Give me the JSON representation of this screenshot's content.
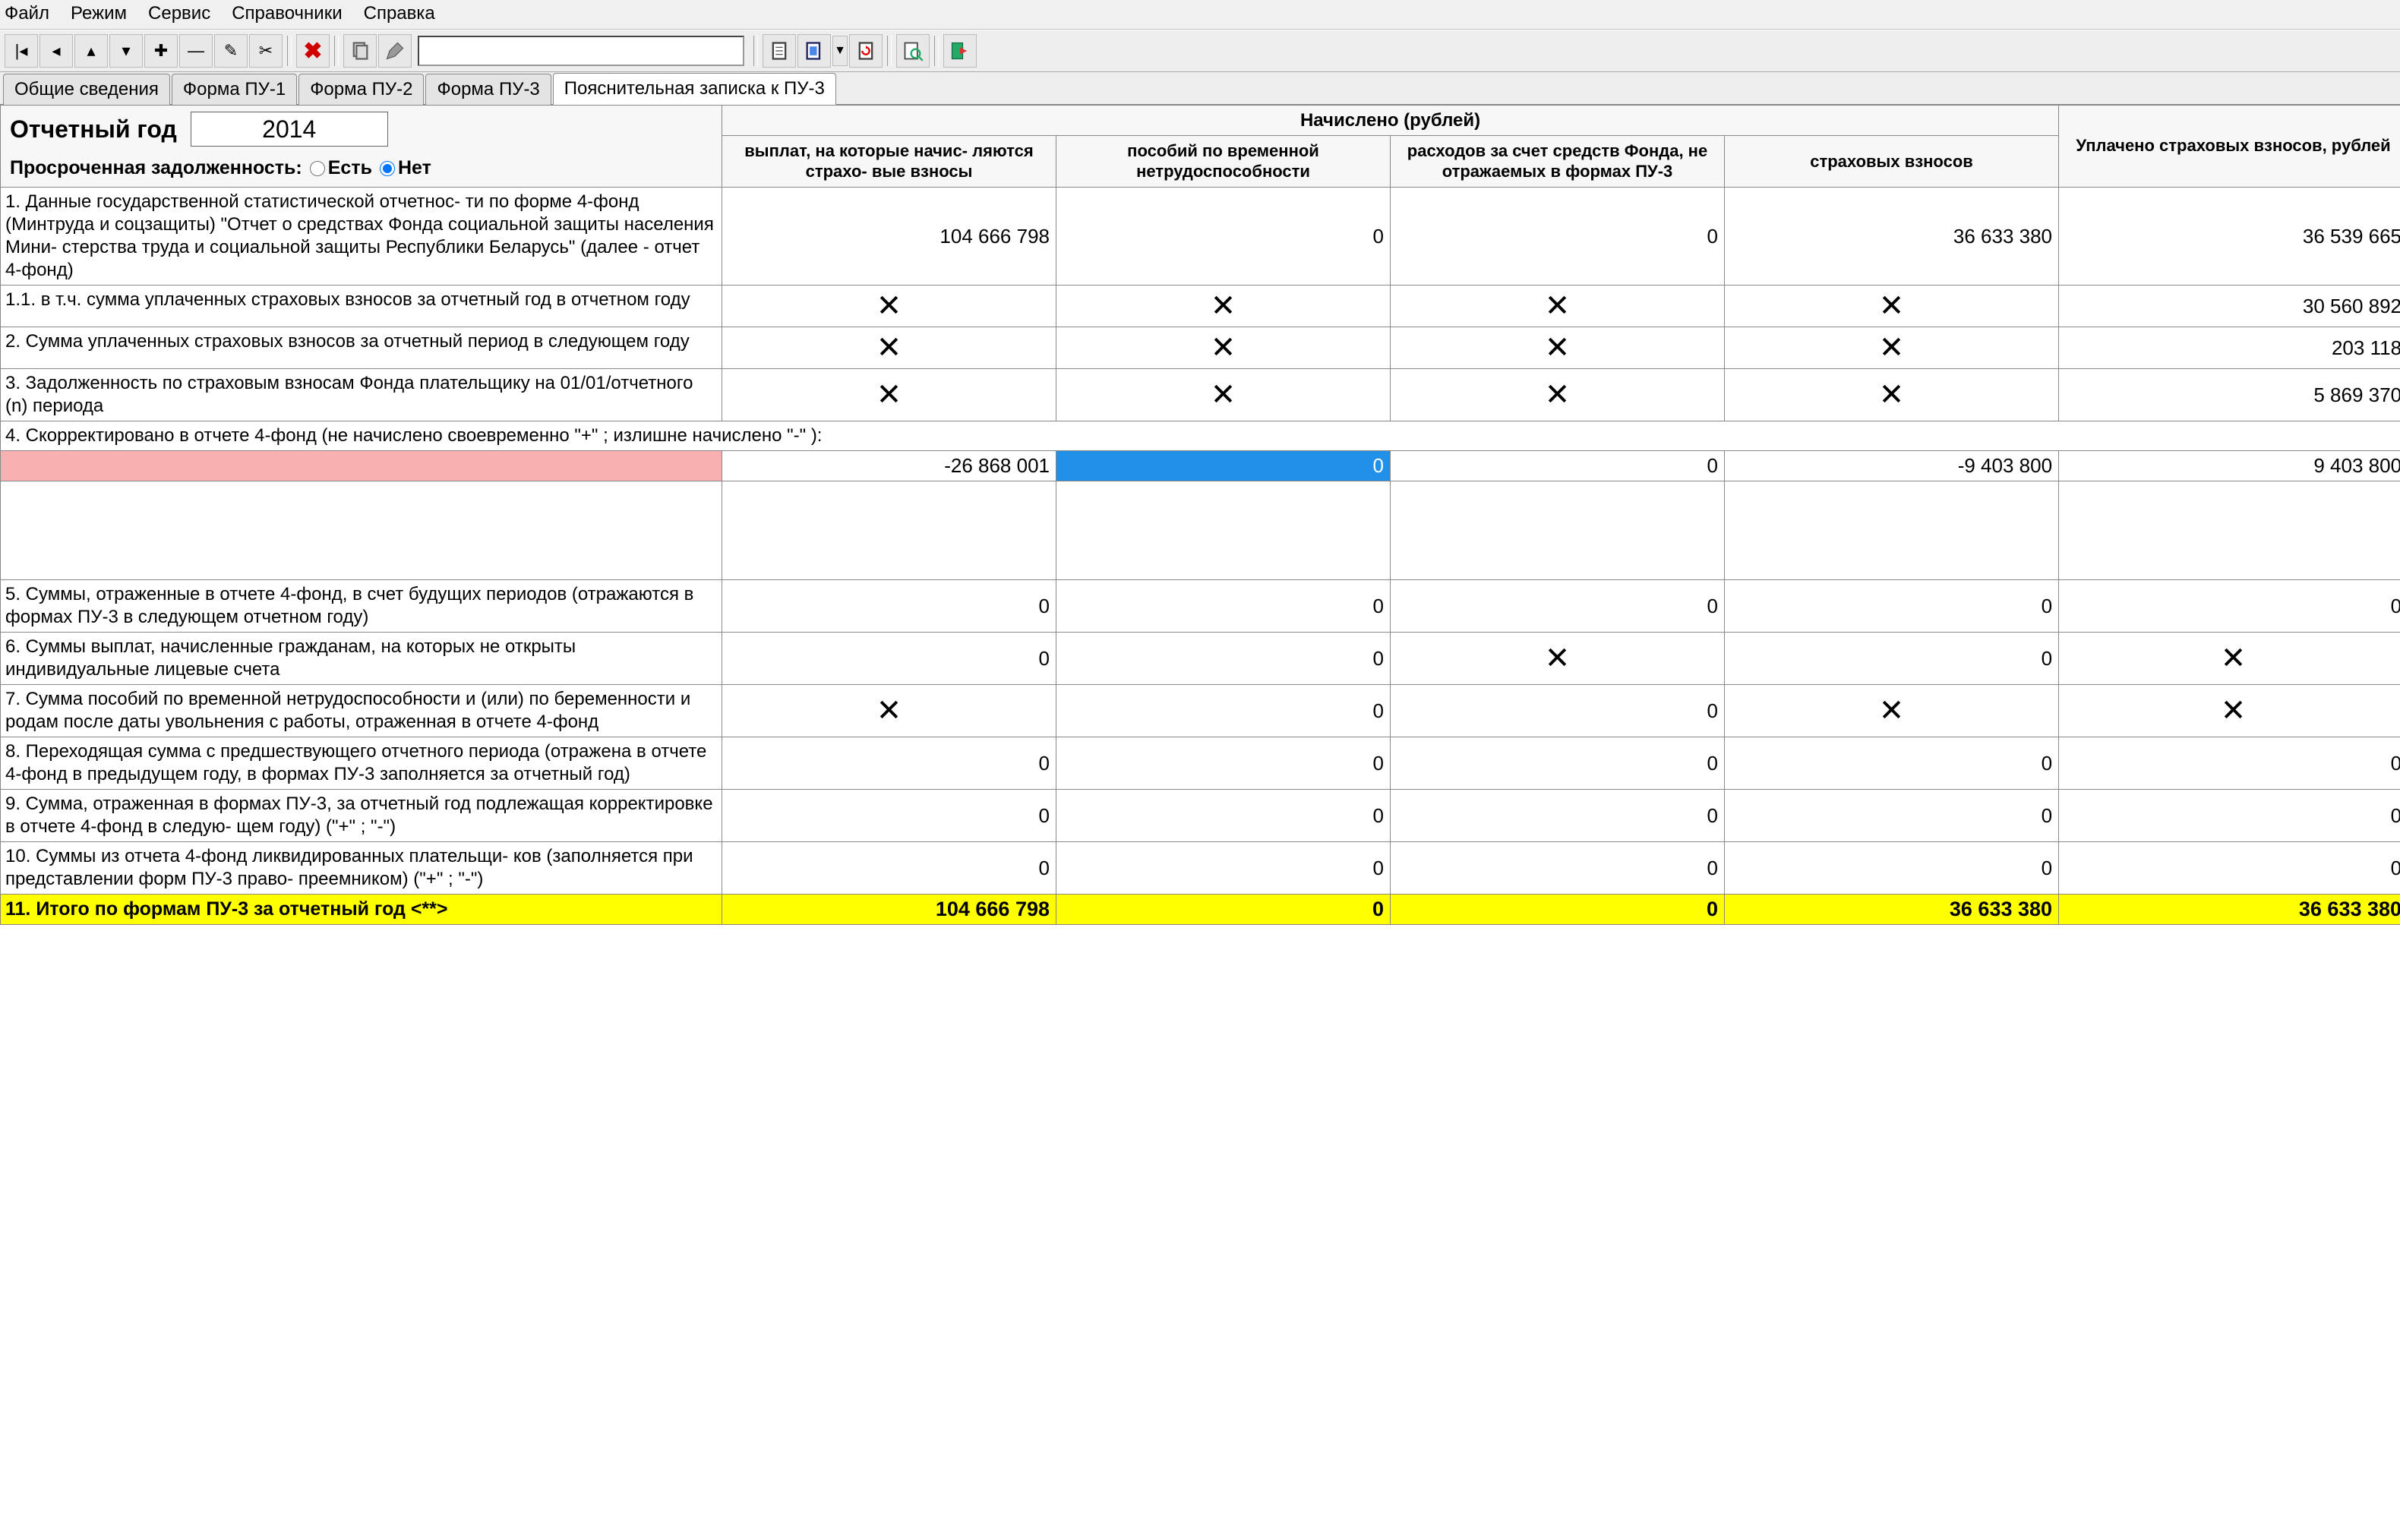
{
  "menu": {
    "file": "Файл",
    "mode": "Режим",
    "service": "Сервис",
    "dict": "Справочники",
    "help": "Справка"
  },
  "tabs": {
    "t1": "Общие сведения",
    "t2": "Форма ПУ-1",
    "t3": "Форма ПУ-2",
    "t4": "Форма ПУ-3",
    "t5": "Пояснительная записка к ПУ-3"
  },
  "header": {
    "year_label": "Отчетный год",
    "year_value": "2014",
    "overdue_label": "Просроченная задолженность:",
    "opt_yes": "Есть",
    "opt_no": "Нет"
  },
  "th": {
    "accrued": "Начислено (рублей)",
    "paid": "Уплачено страховых взносов, рублей",
    "c1": "выплат, на которые начис-\nляются страхо-\nвые взносы",
    "c2": "пособий по временной нетрудоспособности",
    "c3": "расходов за счет средств Фонда, не отражаемых в формах ПУ-3",
    "c4": "страховых взносов"
  },
  "rows": {
    "r1": {
      "desc": "1. Данные государственной статистической отчетнос-\nти по форме 4-фонд (Минтруда и соцзащиты) \"Отчет о средствах Фонда социальной защиты населения Мини-\nстерства труда и социальной защиты Республики Беларусь\" (далее - отчет 4-фонд)",
      "v1": "104 666 798",
      "v2": "0",
      "v3": "0",
      "v4": "36 633 380",
      "v5": "36 539 665"
    },
    "r11": {
      "desc": "  1.1. в т.ч. сумма уплаченных страховых взносов за отчетный год в отчетном году",
      "v5": "30 560 892"
    },
    "r2": {
      "desc": "2. Сумма уплаченных страховых взносов за отчетный период в следующем году",
      "v5": "203 118"
    },
    "r3": {
      "desc": "3. Задолженность по страховым взносам Фонда плательщику на 01/01/отчетного (n) периода",
      "v5": "5 869 370"
    },
    "r4": {
      "desc": "4. Скорректировано в отчете 4-фонд  (не начислено своевременно \"+\" ; излишне начислено \"-\" ):",
      "v1": "-26 868 001",
      "v2": "0",
      "v3": "0",
      "v4": "-9 403 800",
      "v5": "9 403 800"
    },
    "r5": {
      "desc": "5. Суммы, отраженные в отчете 4-фонд, в счет будущих периодов (отражаются в формах ПУ-3 в следующем отчетном году)",
      "v1": "0",
      "v2": "0",
      "v3": "0",
      "v4": "0",
      "v5": "0"
    },
    "r6": {
      "desc": "6. Суммы выплат, начисленные гражданам, на которых не открыты индивидуальные лицевые счета",
      "v1": "0",
      "v2": "0",
      "v4": "0"
    },
    "r7": {
      "desc": "7. Сумма пособий по временной нетрудоспособности и (или) по беременности и родам после даты увольнения с работы, отраженная в отчете  4-фонд",
      "v2": "0",
      "v3": "0"
    },
    "r8": {
      "desc": "8. Переходящая сумма с предшествующего отчетного периода (отражена в отчете 4-фонд в предыдущем году, в формах ПУ-3 заполняется за отчетный год)",
      "v1": "0",
      "v2": "0",
      "v3": "0",
      "v4": "0",
      "v5": "0"
    },
    "r9": {
      "desc": "9. Сумма, отраженная в формах ПУ-3, за отчетный год подлежащая корректировке в отчете 4-фонд в следую-\nщем году) (\"+\" ; \"-\")",
      "v1": "0",
      "v2": "0",
      "v3": "0",
      "v4": "0",
      "v5": "0"
    },
    "r10": {
      "desc": "10. Суммы из отчета 4-фонд  ликвидированных плательщи-\nков (заполняется при представлении форм ПУ-3 право-\nпреемником) (\"+\" ; \"-\")",
      "v1": "0",
      "v2": "0",
      "v3": "0",
      "v4": "0",
      "v5": "0"
    },
    "r11t": {
      "desc": "11. Итого по формам ПУ-3 за отчетный год  <**>",
      "v1": "104 666 798",
      "v2": "0",
      "v3": "0",
      "v4": "36 633 380",
      "v5": "36 633 380"
    }
  },
  "x": "✕"
}
